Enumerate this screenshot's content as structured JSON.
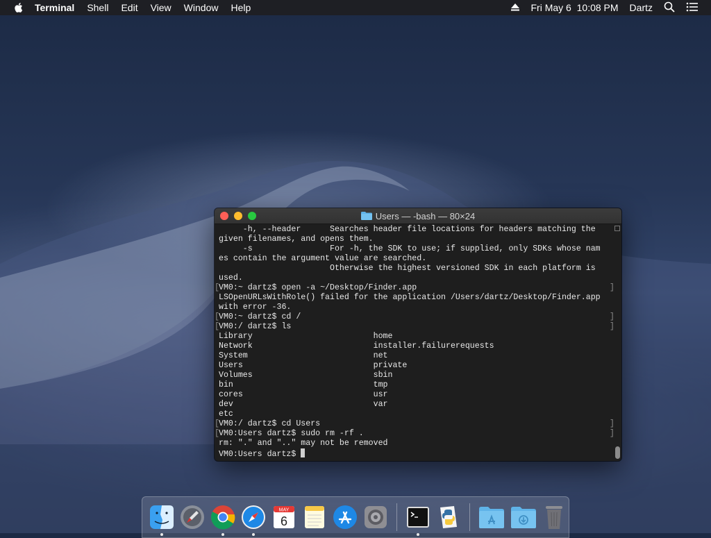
{
  "menubar": {
    "app_name": "Terminal",
    "items": [
      "Shell",
      "Edit",
      "View",
      "Window",
      "Help"
    ],
    "datetime": "Fri May 6  10:08 PM",
    "user": "Dartz"
  },
  "window": {
    "title": "Users — -bash — 80×24",
    "lines": [
      "     -h, --header      Searches header file locations for headers matching the",
      "given filenames, and opens them.",
      "     -s                For -h, the SDK to use; if supplied, only SDKs whose nam",
      "es contain the argument value are searched.",
      "                       Otherwise the highest versioned SDK in each platform is",
      "used.",
      "VM0:~ dartz$ open -a ~/Desktop/Finder.app",
      "LSOpenURLsWithRole() failed for the application /Users/dartz/Desktop/Finder.app",
      "with error -36.",
      "VM0:~ dartz$ cd /",
      "VM0:/ dartz$ ls",
      "Library                         home",
      "Network                         installer.failurerequests",
      "System                          net",
      "Users                           private",
      "Volumes                         sbin",
      "bin                             tmp",
      "cores                           usr",
      "dev                             var",
      "etc",
      "VM0:/ dartz$ cd Users",
      "VM0:Users dartz$ sudo rm -rf .",
      "rm: \".\" and \"..\" may not be removed",
      "VM0:Users dartz$ "
    ],
    "prompt_lines": [
      6,
      9,
      10,
      20,
      21
    ]
  },
  "dock": {
    "apps": [
      "finder-icon",
      "launchpad-icon",
      "chrome-icon",
      "safari-icon",
      "calendar-icon",
      "notes-icon",
      "app-store-icon",
      "system-preferences-icon",
      "terminal-icon",
      "python-launcher-icon",
      "applications-folder-icon",
      "downloads-folder-icon",
      "trash-icon"
    ],
    "calendar": {
      "month": "MAY",
      "day": "6"
    }
  }
}
